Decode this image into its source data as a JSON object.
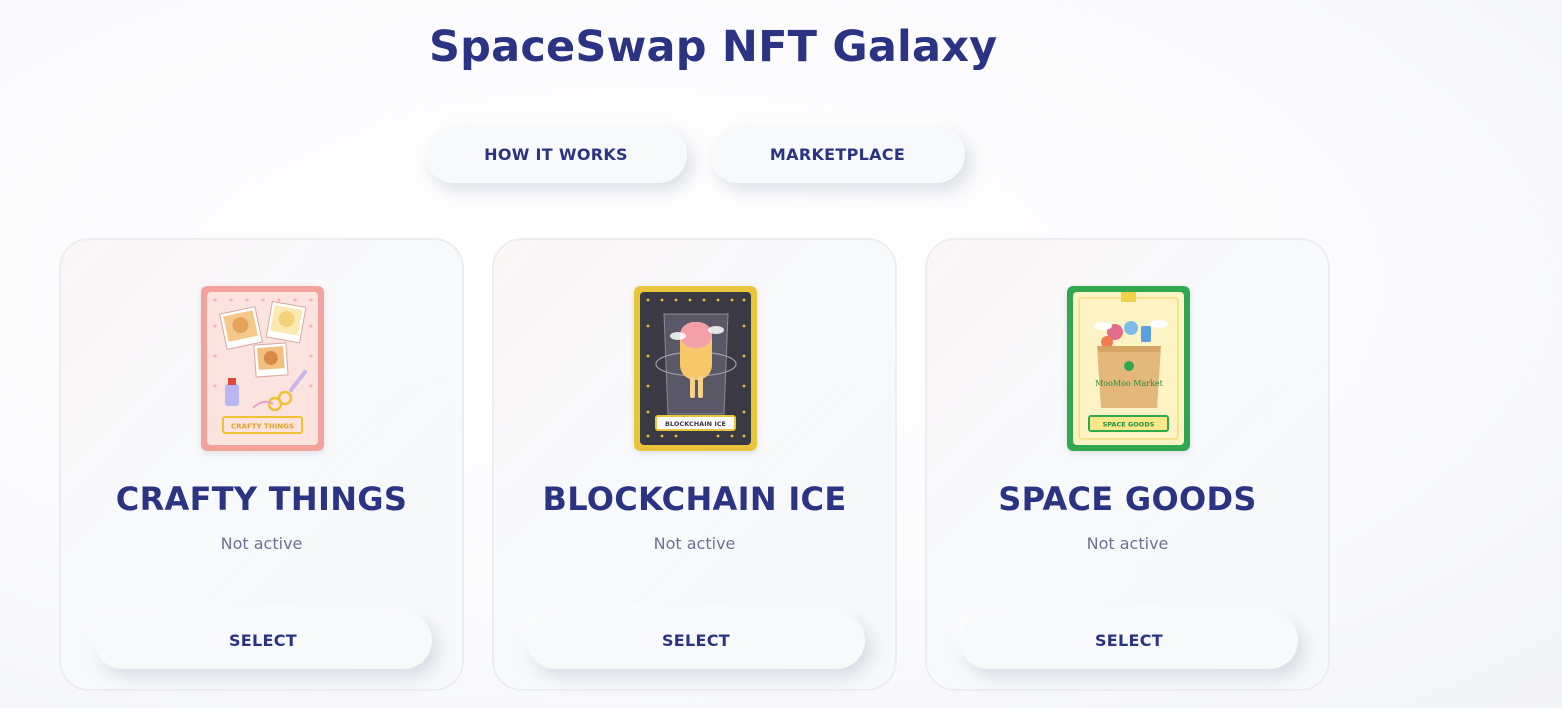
{
  "header": {
    "title": "SpaceSwap NFT Galaxy"
  },
  "nav": {
    "how_it_works": "HOW IT WORKS",
    "marketplace": "MARKETPLACE"
  },
  "collections": [
    {
      "name": "CRAFTY THINGS",
      "status": "Not active",
      "select_label": "SELECT",
      "art_label": "CRAFTY THINGS",
      "icon": "crafty-things-art",
      "accent": "#f2a0a0"
    },
    {
      "name": "BLOCKCHAIN ICE",
      "status": "Not active",
      "select_label": "SELECT",
      "art_label": "BLOCKCHAIN ICE",
      "icon": "blockchain-ice-art",
      "accent": "#e8c840"
    },
    {
      "name": "SPACE GOODS",
      "status": "Not active",
      "select_label": "SELECT",
      "art_label": "SPACE GOODS",
      "art_text": "MooMoo Market",
      "icon": "space-goods-art",
      "accent": "#2fa84f"
    }
  ],
  "colors": {
    "primary_text": "#2b3383",
    "muted_text": "#6e7391",
    "button_bg": "#f7f9fb"
  }
}
